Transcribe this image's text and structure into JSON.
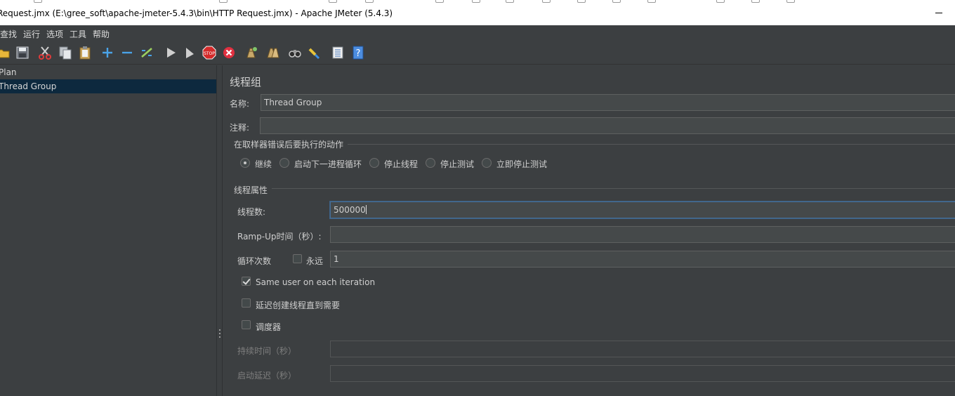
{
  "window": {
    "title": "Request.jmx (E:\\gree_soft\\apache-jmeter-5.4.3\\bin\\HTTP Request.jmx) - Apache JMeter (5.4.3)"
  },
  "menu": [
    "查找",
    "运行",
    "选项",
    "工具",
    "帮助"
  ],
  "toolbar": {
    "icons": [
      "open-icon",
      "save-icon",
      "cut-icon",
      "copy-icon",
      "paste-icon",
      "expand-icon",
      "collapse-icon",
      "toggle-icon",
      "start-icon",
      "start-no-pauses-icon",
      "stop-icon",
      "shutdown-icon",
      "clear-icon",
      "clear-all-icon",
      "search-icon",
      "reset-search-icon",
      "function-helper-icon",
      "help-icon"
    ]
  },
  "tree": {
    "items": [
      {
        "label": "Plan"
      },
      {
        "label": "Thread Group"
      }
    ]
  },
  "panel": {
    "heading": "线程组",
    "name_label": "名称:",
    "name_value": "Thread Group",
    "comment_label": "注释:",
    "comment_value": "",
    "error_action_title": "在取样器错误后要执行的动作",
    "error_actions": [
      {
        "label": "继续",
        "selected": true
      },
      {
        "label": "启动下一进程循环",
        "selected": false
      },
      {
        "label": "停止线程",
        "selected": false
      },
      {
        "label": "停止测试",
        "selected": false
      },
      {
        "label": "立即停止测试",
        "selected": false
      }
    ],
    "thread_props_title": "线程属性",
    "threads_label": "线程数:",
    "threads_value": "500000",
    "rampup_label": "Ramp-Up时间（秒）:",
    "rampup_value": "",
    "loop_label": "循环次数",
    "forever_label": "永远",
    "forever_checked": false,
    "loop_value": "1",
    "same_user_label": "Same user on each iteration",
    "same_user_checked": true,
    "delay_label": "延迟创建线程直到需要",
    "delay_checked": false,
    "scheduler_label": "调度器",
    "scheduler_checked": false,
    "duration_label": "持续时间（秒）",
    "duration_value": "",
    "startup_delay_label": "启动延迟（秒）",
    "startup_delay_value": ""
  }
}
